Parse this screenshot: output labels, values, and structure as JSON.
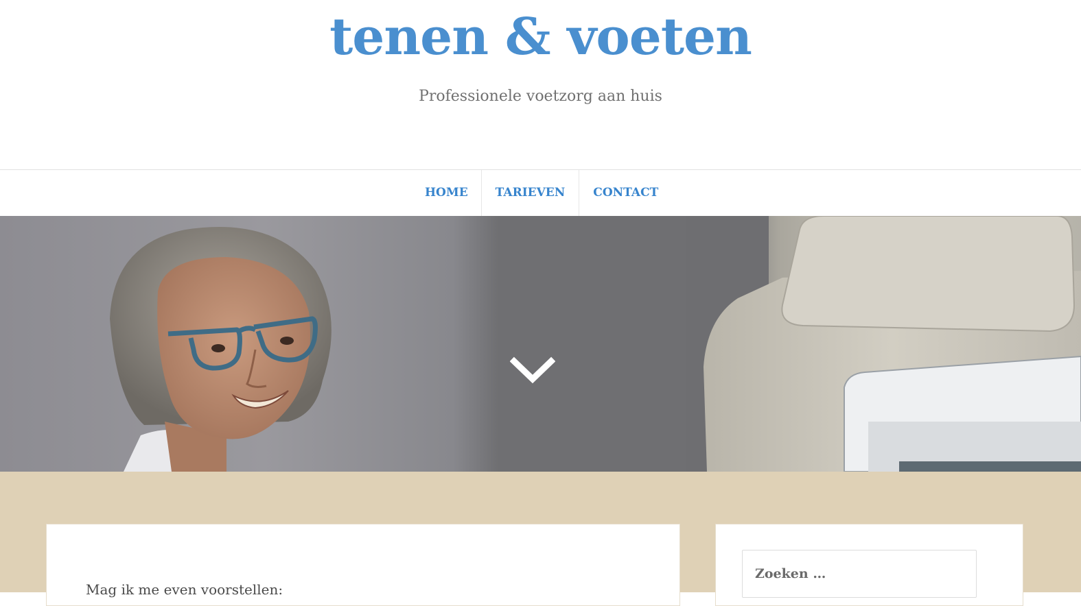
{
  "site": {
    "title": "tenen & voeten",
    "tagline": "Professionele voetzorg aan huis"
  },
  "nav": {
    "items": [
      {
        "label": "HOME"
      },
      {
        "label": "TARIEVEN"
      },
      {
        "label": "CONTACT"
      }
    ]
  },
  "hero": {
    "scroll_icon": "chevron-down-icon"
  },
  "main": {
    "intro": "Mag ik me even voorstellen:"
  },
  "sidebar": {
    "search_placeholder": "Zoeken …"
  },
  "colors": {
    "accent": "#4a8fcf",
    "nav_link": "#3784cd",
    "content_background": "#dfd1b6"
  }
}
